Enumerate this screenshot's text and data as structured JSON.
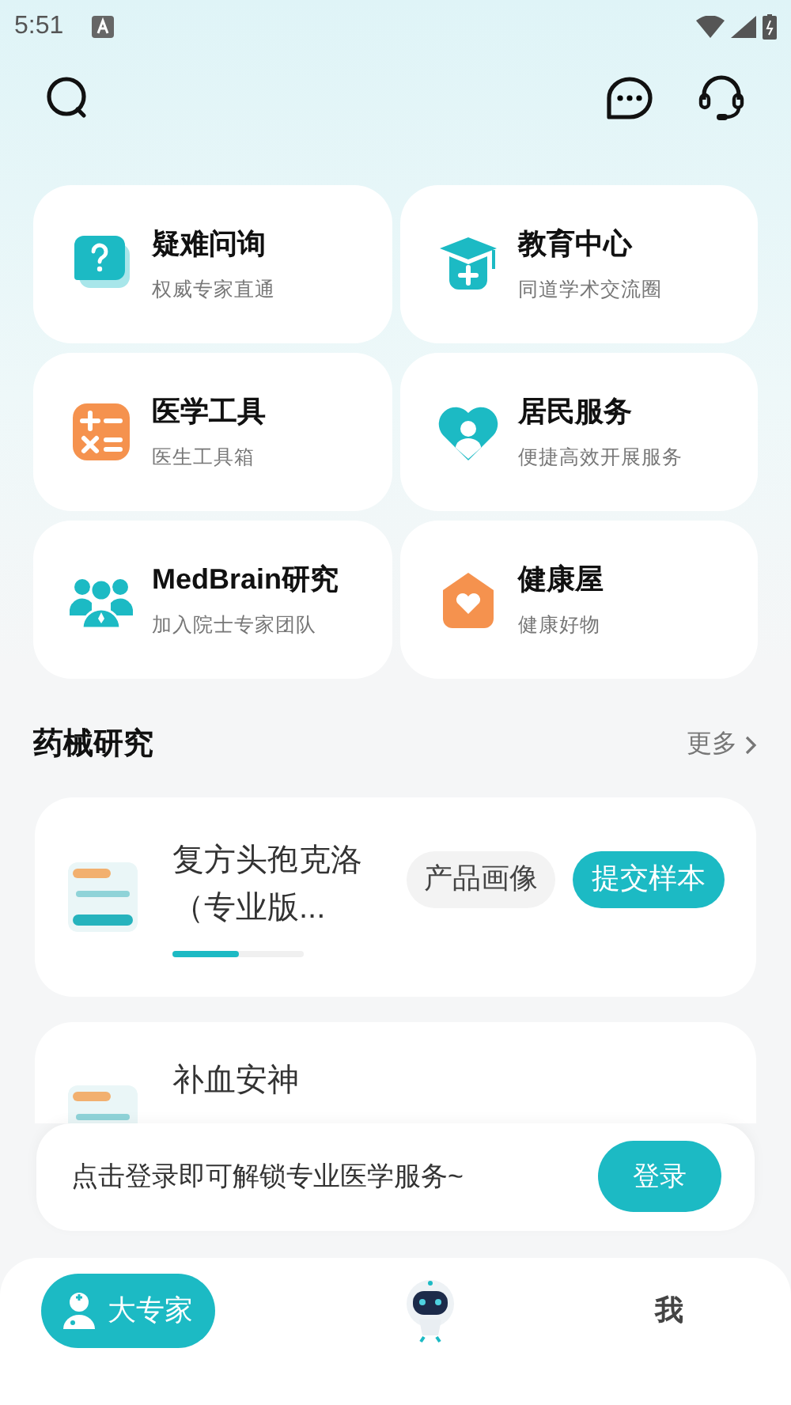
{
  "status_bar": {
    "time": "5:51"
  },
  "services": [
    {
      "title": "疑难问询",
      "subtitle": "权威专家直通",
      "kind": "question"
    },
    {
      "title": "教育中心",
      "subtitle": "同道学术交流圈",
      "kind": "cap"
    },
    {
      "title": "医学工具",
      "subtitle": "医生工具箱",
      "kind": "calculator"
    },
    {
      "title": "居民服务",
      "subtitle": "便捷高效开展服务",
      "kind": "heart"
    },
    {
      "title": "MedBrain研究",
      "subtitle": "加入院士专家团队",
      "kind": "team"
    },
    {
      "title": "健康屋",
      "subtitle": "健康好物",
      "kind": "house"
    }
  ],
  "section": {
    "title": "药械研究",
    "more": "更多"
  },
  "products": [
    {
      "name": "复方头孢克洛（专业版...",
      "tag": "产品画像",
      "action": "提交样本",
      "level": 0.5
    },
    {
      "name": "补血安神"
    }
  ],
  "login_banner": {
    "text": "点击登录即可解锁专业医学服务~",
    "button": "登录"
  },
  "tabs": [
    {
      "label": "大专家",
      "selected": true
    },
    {
      "label": "我",
      "selected": false
    }
  ]
}
